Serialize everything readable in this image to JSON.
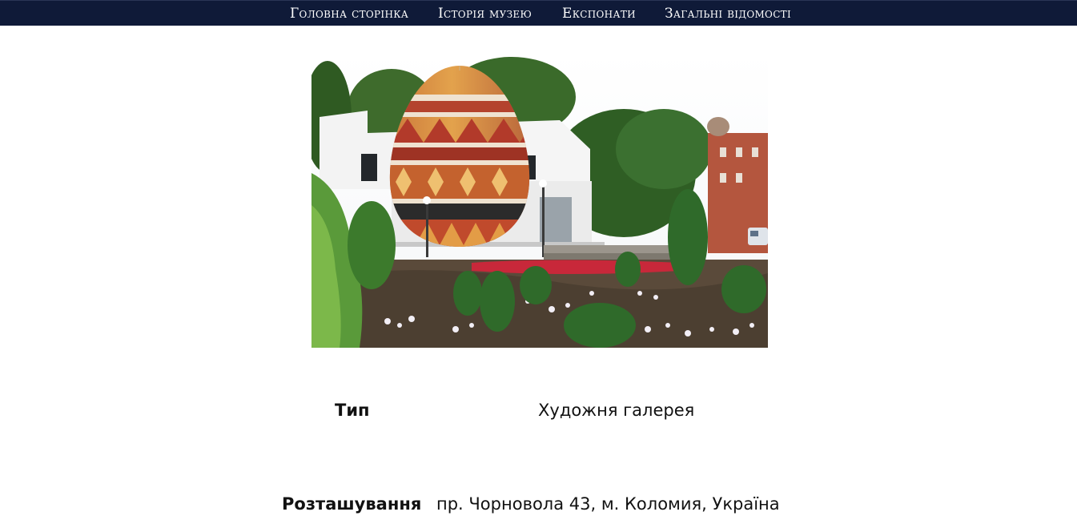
{
  "nav": {
    "items": [
      {
        "label": "Головна сторінка"
      },
      {
        "label": "Історія музею"
      },
      {
        "label": "Експонати"
      },
      {
        "label": "Загальні відомості"
      }
    ]
  },
  "hero": {
    "image": "museum-egg-building-photo"
  },
  "info": {
    "type_label": "Тип",
    "type_value": "Художня галерея",
    "location_label": "Розташування",
    "location_value": "пр. Чорновола 43, м. Коломия, Україна"
  },
  "colors": {
    "nav_background": "#0f1a38",
    "nav_text": "#ffffff",
    "page_background": "#ffffff"
  }
}
